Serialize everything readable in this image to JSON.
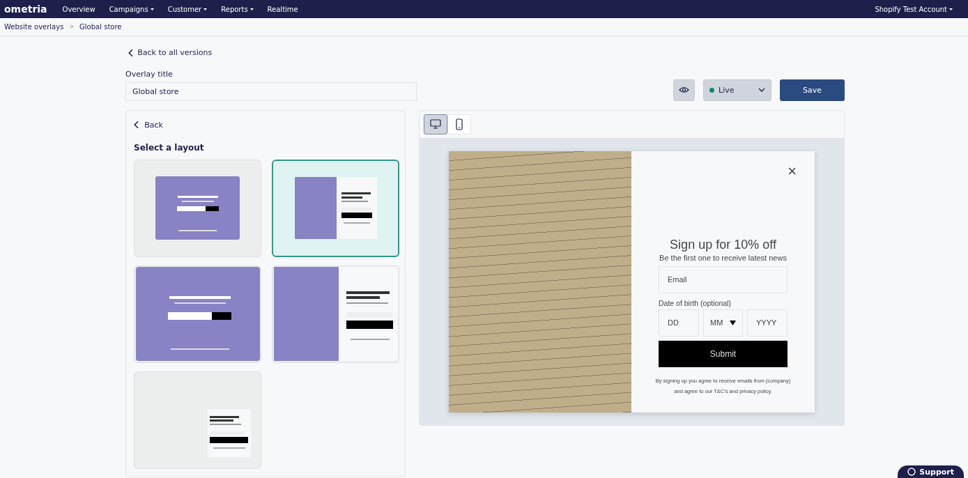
{
  "nav": {
    "logo": "ometria",
    "items": [
      {
        "label": "Overview",
        "dropdown": false
      },
      {
        "label": "Campaigns",
        "dropdown": true
      },
      {
        "label": "Customer",
        "dropdown": true
      },
      {
        "label": "Reports",
        "dropdown": true
      },
      {
        "label": "Realtime",
        "dropdown": false
      }
    ],
    "account": "Shopify Test Account"
  },
  "breadcrumb": {
    "items": [
      "Website overlays",
      "Global store"
    ],
    "separator": ">"
  },
  "back_link": "Back to all versions",
  "overlay_title": {
    "label": "Overlay title",
    "value": "Global store"
  },
  "status": {
    "label": "Live",
    "color": "#0e8a6a"
  },
  "save_button": "Save",
  "panel": {
    "back": "Back",
    "heading": "Select a layout",
    "layouts": [
      {
        "kind": "centered",
        "selected": false
      },
      {
        "kind": "split",
        "selected": true
      },
      {
        "kind": "full-centered",
        "selected": false
      },
      {
        "kind": "full-split",
        "selected": false
      },
      {
        "kind": "corner",
        "selected": false
      }
    ]
  },
  "devices": [
    {
      "kind": "desktop",
      "selected": true
    },
    {
      "kind": "mobile",
      "selected": false
    }
  ],
  "preview": {
    "close": "×",
    "title": "Sign up for 10% off",
    "subtitle": "Be the first one to receive latest news",
    "email_placeholder": "Email",
    "dob_label": "Date of birth (optional)",
    "day_placeholder": "DD",
    "month_placeholder": "MM",
    "year_placeholder": "YYYY",
    "submit": "Submit",
    "legal": "By signing up you agree to receive emails from (company) and agree to our T&C's and privacy policy."
  },
  "support": "Support"
}
